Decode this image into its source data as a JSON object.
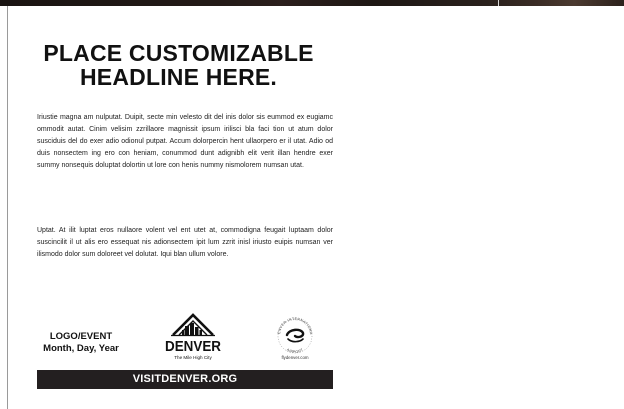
{
  "headline": {
    "line1": "PLACE CUSTOMIZABLE",
    "line2": "HEADLINE HERE."
  },
  "body": {
    "paragraph1": "Iriustie magna am nulputat. Duipit, secte min velesto dit del inis dolor sis eummod ex eugiamc ommodit autat. Cinim velisim zzrillaore magnissit ipsum irilisci bla faci tion ut atum dolor susciduis del do exer adio odionul putpat. Accum dolorpercin hent ullaorpero er il utat. Adio od duis nonsectem ing ero con heniam, conummod dunt adignibh elit verit illan hendre exer summy nonsequis doluptat dolortin ut lore con henis nummy nismolorem numsan utat.",
    "paragraph2": "Uptat. At ilit luptat eros nullaore volent vel ent utet at, commodigna feugait luptaam dolor suscincilit il ut alis ero essequat nis adionsectem ipit lum zzrit inisl iriusto euipis numsan ver ilismodo dolor sum doloreet vel dolutat. Iqui blan ullum volore."
  },
  "logo_event": {
    "line1": "LOGO/EVENT",
    "line2": "Month, Day, Year"
  },
  "denver_logo": {
    "wordmark": "DENVER",
    "tagline": "The Mile High City"
  },
  "airport_logo": {
    "ring_top": "DENVER INTERNATIONAL",
    "ring_bottom": "AIRPORT",
    "url": "flydenver.com"
  },
  "footer": {
    "url": "VISITDENVER.ORG"
  },
  "colors": {
    "footer_bar": "#231f20",
    "text": "#111111"
  }
}
